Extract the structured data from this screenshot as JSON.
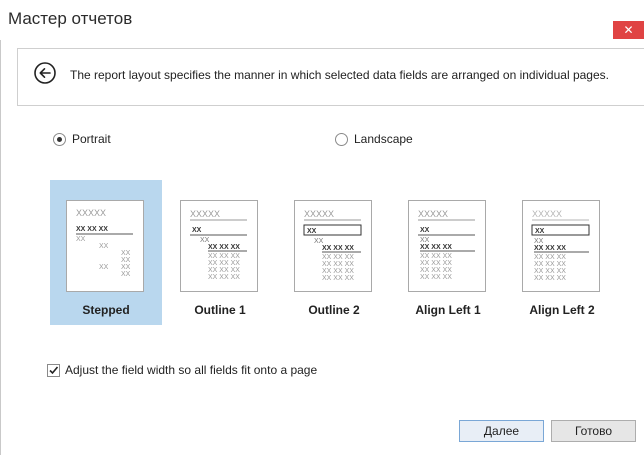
{
  "window": {
    "title": "Мастер отчетов",
    "close_label": "✕"
  },
  "header": {
    "back_icon": "back-arrow-circle-icon",
    "description": "The report layout specifies the manner in which selected data fields are arranged on individual pages."
  },
  "orientation": {
    "selected": "Portrait",
    "options": [
      {
        "label": "Portrait",
        "checked": true
      },
      {
        "label": "Landscape",
        "checked": false
      }
    ]
  },
  "layouts": [
    {
      "label": "Stepped",
      "selected": true,
      "caption": "XXXXX",
      "cells": [
        "XX",
        "XX"
      ]
    },
    {
      "label": "Outline 1",
      "selected": false,
      "caption": "XXXXX",
      "cells": [
        "XX",
        "XX",
        "XX XX XX"
      ]
    },
    {
      "label": "Outline 2",
      "selected": false,
      "caption": "XXXXX",
      "cells": [
        "XX",
        "XX",
        "XX XX XX"
      ]
    },
    {
      "label": "Align Left 1",
      "selected": false,
      "caption": "XXXXX",
      "cells": [
        "XX",
        "XX",
        "XX XX XX"
      ]
    },
    {
      "label": "Align Left 2",
      "selected": false,
      "caption": "XXXXX",
      "cells": [
        "XX",
        "XX",
        "XX XX XX"
      ]
    }
  ],
  "adjust_width": {
    "label": "Adjust the field width so all fields fit onto a page",
    "checked": true
  },
  "buttons": {
    "next": "Далее",
    "finish": "Готово"
  }
}
